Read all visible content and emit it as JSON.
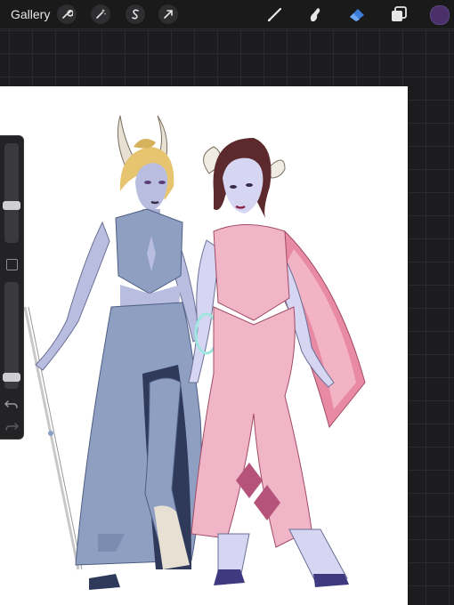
{
  "topbar": {
    "gallery_label": "Gallery",
    "left_tools": [
      "wrench-icon",
      "magic-wand-icon",
      "selection-s-icon",
      "transform-arrow-icon"
    ],
    "right_tools": [
      "brush-icon",
      "smudge-icon",
      "eraser-icon",
      "layers-icon"
    ],
    "active_tool": "eraser-icon",
    "current_color": "#4a2f6b"
  },
  "sidebar": {
    "brush_size_level": 0.36,
    "opacity_level": 0.07,
    "icons": [
      "modify-square-icon",
      "undo-icon",
      "redo-icon"
    ]
  },
  "colors": {
    "accent_blue": "#3b7dd8",
    "skin_left": "#b9bde0",
    "dress_left": "#8e9fc2",
    "skin_right": "#d6d6f2",
    "dress_right": "#f0b5c6",
    "cape": "#e88aa3"
  }
}
